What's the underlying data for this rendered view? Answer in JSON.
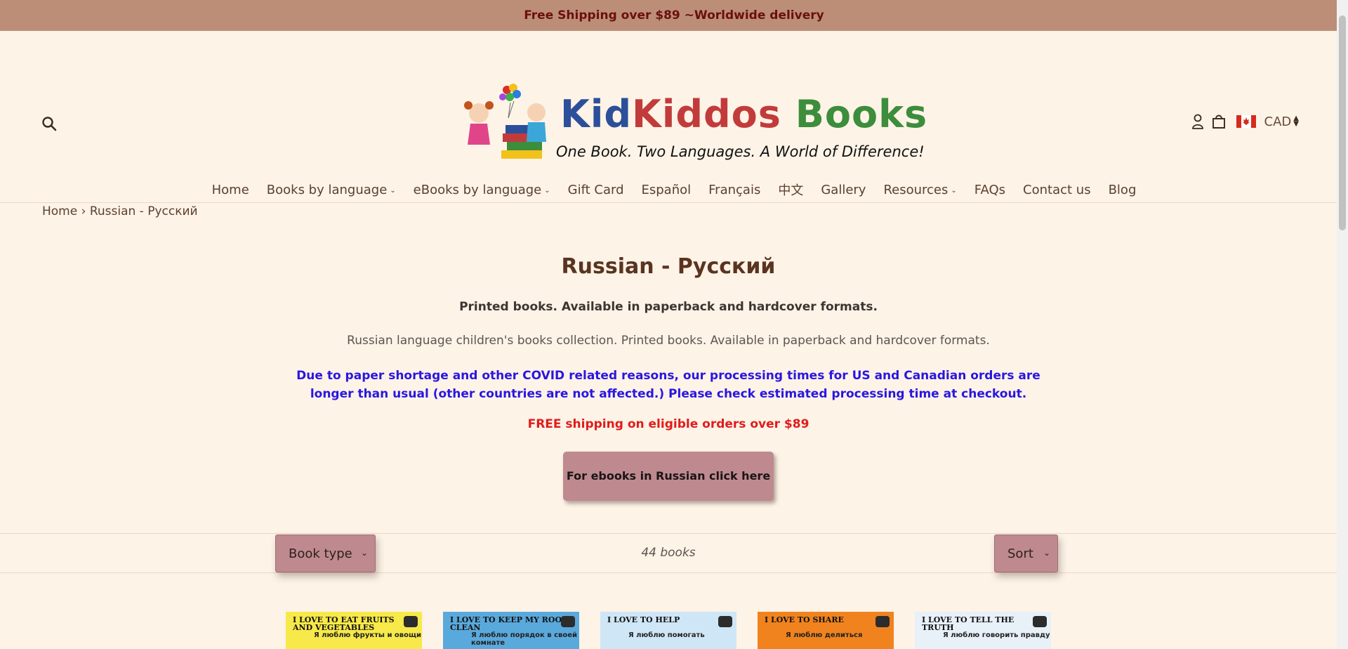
{
  "announcement": "Free Shipping over $89 ~Worldwide delivery",
  "logo": {
    "title_part1": "Kid",
    "title_part2": "Kiddos",
    "title_part3": "Books",
    "tagline": "One Book. Two Languages. A World of Difference!"
  },
  "header": {
    "currency": "CAD",
    "icons": [
      "search-icon",
      "account-icon",
      "cart-icon",
      "canada-flag-icon"
    ]
  },
  "nav": [
    {
      "label": "Home",
      "dropdown": false
    },
    {
      "label": "Books by language",
      "dropdown": true
    },
    {
      "label": "eBooks by language",
      "dropdown": true
    },
    {
      "label": "Gift Card",
      "dropdown": false
    },
    {
      "label": "Español",
      "dropdown": false
    },
    {
      "label": "Français",
      "dropdown": false
    },
    {
      "label": "中文",
      "dropdown": false
    },
    {
      "label": "Gallery",
      "dropdown": false
    },
    {
      "label": "Resources",
      "dropdown": true
    },
    {
      "label": "FAQs",
      "dropdown": false
    },
    {
      "label": "Contact us",
      "dropdown": false
    },
    {
      "label": "Blog",
      "dropdown": false
    }
  ],
  "breadcrumb": {
    "home": "Home",
    "separator": "›",
    "current": "Russian - Русский"
  },
  "main": {
    "title": "Russian - Русский",
    "subtitle": "Printed books. Available in paperback and hardcover formats.",
    "description": "Russian language children's books collection. Printed books. Available in paperback and hardcover formats.",
    "covid_notice": "Due to paper shortage and other COVID related reasons, our processing times for US and Canadian orders are longer than usual (other countries are not affected.) Please check estimated processing time at checkout.",
    "free_shipping": "FREE shipping on eligible orders over $89",
    "ebook_button": "For ebooks in Russian click here"
  },
  "filters": {
    "book_type_label": "Book type",
    "sort_label": "Sort",
    "count": "44 books"
  },
  "products": [
    {
      "title": "I Love to Eat Fruits and Vegetables",
      "ru": "Я люблю фрукты и овощи",
      "bg": "#f7e94a"
    },
    {
      "title": "I Love to Keep My Room Clean",
      "ru": "Я люблю порядок в своей комнате",
      "bg": "#5aa9dc"
    },
    {
      "title": "I Love to Help",
      "ru": "Я люблю помогать",
      "bg": "#cfe6f6"
    },
    {
      "title": "I Love to Share",
      "ru": "Я люблю делиться",
      "bg": "#f0831e"
    },
    {
      "title": "I Love to Tell the Truth",
      "ru": "Я люблю говорить правду",
      "bg": "#e8f0f8"
    }
  ],
  "colors": {
    "background": "#fdf3e7",
    "announcement_bg": "#bc8e78",
    "announcement_text": "#6b0f0f",
    "button_bg": "#be8a8f",
    "covid_text": "#2a16e0",
    "free_text": "#e01c1c"
  }
}
